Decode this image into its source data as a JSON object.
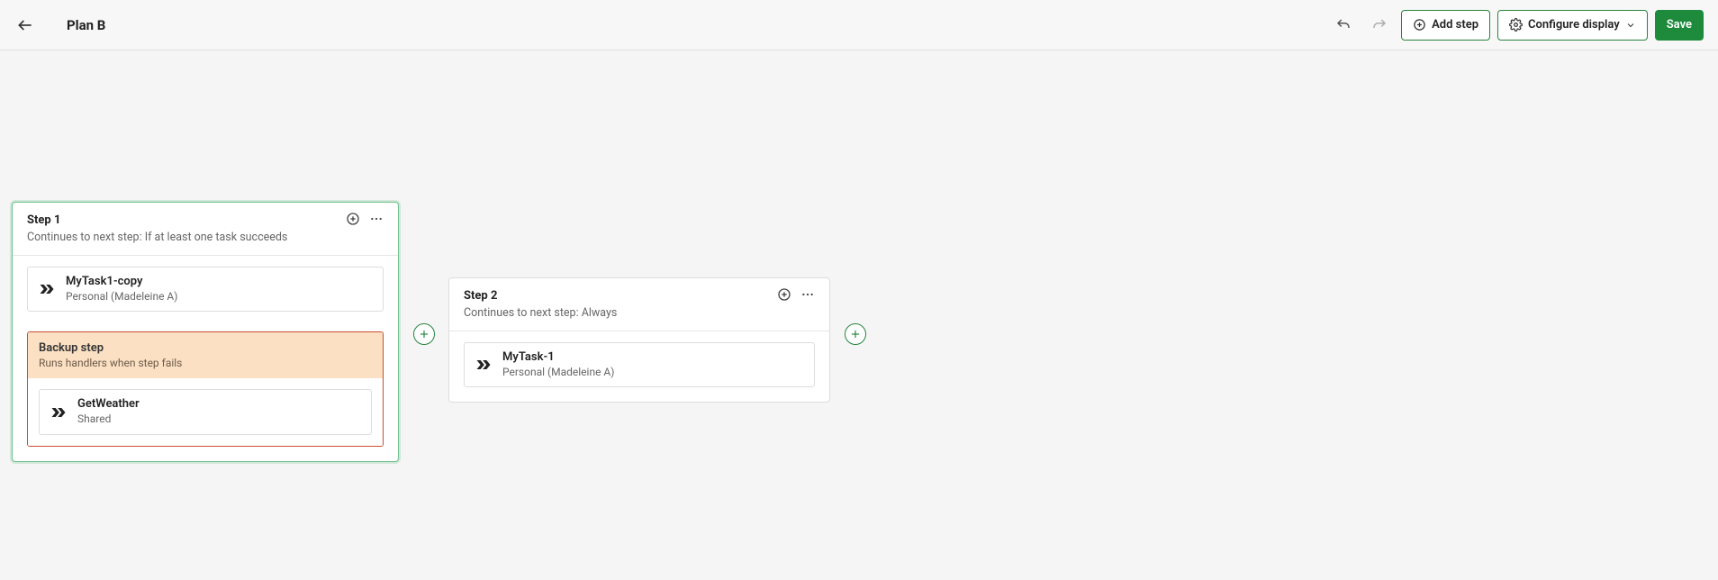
{
  "header": {
    "title": "Plan B",
    "add_step_label": "Add step",
    "configure_display_label": "Configure display",
    "save_label": "Save"
  },
  "steps": [
    {
      "title": "Step 1",
      "continues": "Continues to next step: If at least one task succeeds",
      "task": {
        "name": "MyTask1-copy",
        "location": "Personal (Madeleine A)"
      },
      "backup": {
        "title": "Backup step",
        "subtitle": "Runs handlers when step fails",
        "task": {
          "name": "GetWeather",
          "location": "Shared"
        }
      }
    },
    {
      "title": "Step 2",
      "continues": "Continues to next step: Always",
      "task": {
        "name": "MyTask-1",
        "location": "Personal (Madeleine A)"
      }
    }
  ]
}
